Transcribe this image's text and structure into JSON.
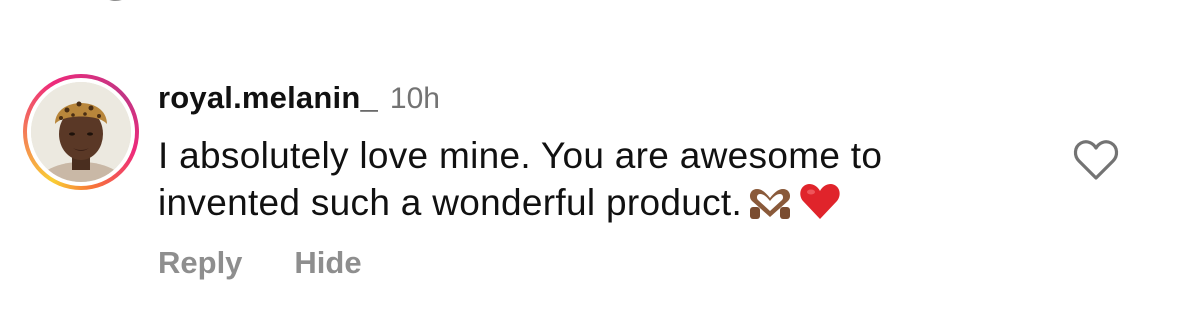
{
  "comment": {
    "username": "royal.melanin_",
    "timestamp": "10h",
    "text_line_1": "I absolutely love mine. You are awesome to",
    "text_line_2": "invented such a wonderful product.",
    "emojis": [
      "heart-hands-emoji",
      "red-heart-emoji"
    ]
  },
  "actions": {
    "reply_label": "Reply",
    "hide_label": "Hide"
  },
  "icons": {
    "like": "heart-outline-icon"
  },
  "colors": {
    "username": "#111111",
    "timestamp": "#737373",
    "action_text": "#8e8e8e",
    "heart_red": "#e0242b",
    "story_ring_start": "#f9ce34",
    "story_ring_end": "#c13584"
  }
}
